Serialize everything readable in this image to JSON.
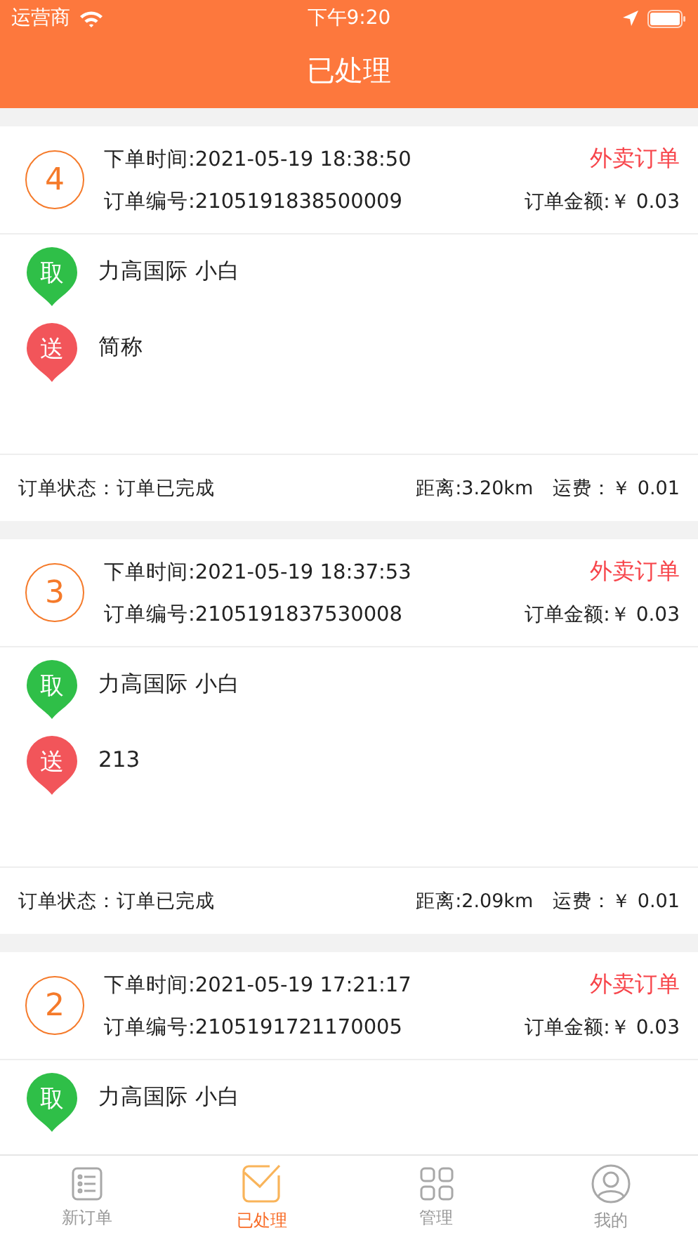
{
  "status_bar": {
    "carrier": "运营商",
    "time": "下午9:20"
  },
  "header": {
    "title": "已处理"
  },
  "orders": [
    {
      "number": "4",
      "time_label": "下单时间:2021-05-19 18:38:50",
      "type": "外卖订单",
      "order_no": "订单编号:2105191838500009",
      "amount": "订单金额:￥ 0.03",
      "stops": [
        {
          "kind": "pickup",
          "badge": "取",
          "text": "力高国际  小白"
        },
        {
          "kind": "dropoff",
          "badge": "送",
          "text": "简称"
        }
      ],
      "status": "订单状态：订单已完成",
      "distance": "距离:3.20km",
      "fee": "运费：￥ 0.01"
    },
    {
      "number": "3",
      "time_label": "下单时间:2021-05-19 18:37:53",
      "type": "外卖订单",
      "order_no": "订单编号:2105191837530008",
      "amount": "订单金额:￥ 0.03",
      "stops": [
        {
          "kind": "pickup",
          "badge": "取",
          "text": "力高国际  小白"
        },
        {
          "kind": "dropoff",
          "badge": "送",
          "text": "213"
        }
      ],
      "status": "订单状态：订单已完成",
      "distance": "距离:2.09km",
      "fee": "运费：￥ 0.01"
    },
    {
      "number": "2",
      "time_label": "下单时间:2021-05-19 17:21:17",
      "type": "外卖订单",
      "order_no": "订单编号:2105191721170005",
      "amount": "订单金额:￥ 0.03",
      "stops": [
        {
          "kind": "pickup",
          "badge": "取",
          "text": "力高国际  小白"
        }
      ]
    }
  ],
  "tabs": [
    {
      "label": "新订单",
      "kind": "list",
      "selected": false
    },
    {
      "label": "已处理",
      "kind": "mail",
      "selected": true
    },
    {
      "label": "管理",
      "kind": "grid",
      "selected": false
    },
    {
      "label": "我的",
      "kind": "user",
      "selected": false
    }
  ]
}
